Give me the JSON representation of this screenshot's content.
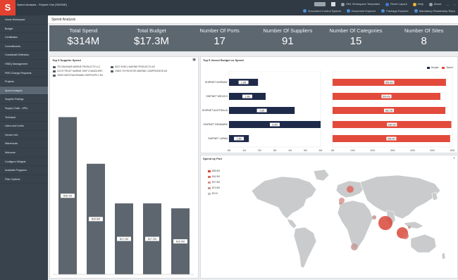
{
  "titlebar": {
    "title": "Spend Analysis - Shipnet One [SNONE]",
    "links": [
      "SN1 Workspace Templates",
      "Reset Layout",
      "Help",
      "About"
    ],
    "sublinks": [
      "Document Control System",
      "Document Explorer",
      "Package Explorer",
      "Mandatory Readership Repo"
    ],
    "logo": "S"
  },
  "sidebar": {
    "items": [
      {
        "label": "Home Workspace"
      },
      {
        "label": "Budget"
      },
      {
        "label": "Certificates"
      },
      {
        "label": "Commitments"
      },
      {
        "label": "Crankshaft Deflection"
      },
      {
        "label": "HSEQ Management"
      },
      {
        "label": "PMS Change Requests"
      },
      {
        "label": "Projects"
      },
      {
        "label": "Spend Analysis"
      },
      {
        "label": "Supplier Ratings"
      },
      {
        "label": "Supply Chain - KPIs"
      },
      {
        "label": "Technical"
      },
      {
        "label": "Users and Limits"
      },
      {
        "label": "Vendor Info"
      },
      {
        "label": "Warehouse"
      },
      {
        "label": "Welcome"
      },
      {
        "label": "Configure Widgets"
      },
      {
        "label": "Available Programs"
      },
      {
        "label": "Filter Options"
      }
    ],
    "active_index": 8
  },
  "header": {
    "title": "Spend Analysis"
  },
  "kpis": [
    {
      "label": "Total Spend",
      "value": "$314M"
    },
    {
      "label": "Total Budget",
      "value": "$17.3M"
    },
    {
      "label": "Number Of Ports",
      "value": "17"
    },
    {
      "label": "Number Of Suppliers",
      "value": "91"
    },
    {
      "label": "Number Of Categories",
      "value": "15"
    },
    {
      "label": "Number Of Sites",
      "value": "8"
    }
  ],
  "supplier_panel": {
    "title": "Top 5 Supplier Spend",
    "legend": [
      "TECHNOMAR MARINE PRODUCTS LLC",
      "22175 TRUST MARINE SHIP CHANDLERS",
      "23923 WESTHAGEMANN SHIPSUPPLY BV",
      "8237 SHELL MARINE PRODUCTS AS",
      "24902 THYROSTOR MARINE COMPRESSOR AS"
    ]
  },
  "vessel_panel": {
    "title": "Top 5 Vessel Budget vs Spend",
    "legend": [
      "Budget",
      "Spend"
    ]
  },
  "port_panel": {
    "title": "Spend by Port",
    "legend": [
      "$55.9M",
      "$41.9M",
      "$27.9M",
      "$13.9M",
      "$0.01"
    ]
  },
  "colors": {
    "budget": "#1f2a4a",
    "spend": "#e24b3b",
    "supplier_bar": "#5d666e",
    "sidebar": "#38434d",
    "kpi_band": "#5d6770",
    "map_land": "#c9cbcd"
  },
  "chart_data": [
    {
      "type": "bar",
      "title": "Top 5 Supplier Spend",
      "categories": [
        "TECHNOMAR MARINE PRODUCTS LLC",
        "22175 TRUST MARINE SHIP CHANDLERS",
        "23923 WESTHAGEMANN SHIPSUPPLY BV",
        "8237 SHELL MARINE PRODUCTS AS",
        "24902 THYROSTOR MARINE COMPRESSOR AS"
      ],
      "values": [
        38.1,
        26.8,
        17.2,
        17.2,
        16.0
      ],
      "labels": [
        "$38.1M",
        "$26.8M",
        "$17.2M",
        "$17.2M",
        "$16.0M"
      ],
      "ylim": [
        0,
        45
      ]
    },
    {
      "type": "bar",
      "title": "Top 5 Vessel Budget vs Spend",
      "orientation": "horizontal",
      "categories": [
        "SHIPNET NORWAY",
        "SHIPNET MEXICO",
        "SHIPNET AUSTRALIA",
        "SHIPNET DENMARK",
        "SHIPNET JAPAN"
      ],
      "panels": [
        {
          "name": "Budget",
          "xlabel": "Budget",
          "ticks": [
            "0M",
            "1M",
            "2M",
            "3M",
            "4M",
            "5M",
            "6M"
          ],
          "xlim": [
            0,
            6
          ],
          "values": [
            1.9,
            2.4,
            4.3,
            6.0,
            1.3
          ],
          "labels": [
            "1.9M",
            "2.4M",
            "4.3M",
            "6.0M",
            "1.3M"
          ],
          "color": "#1f2a4a"
        },
        {
          "name": "Spend",
          "xlabel": "Spend",
          "ticks": [
            "0M",
            "10M",
            "20M",
            "30M",
            "40M",
            "50M",
            "60M"
          ],
          "xlim": [
            0,
            60
          ],
          "values": [
            56.8,
            54.0,
            56.5,
            59.5,
            58.9
          ],
          "labels": [
            "$56.8M",
            "$54.0M",
            "$56.5M",
            "$59.5M",
            "$58.9M"
          ],
          "color": "#e24b3b"
        }
      ]
    }
  ]
}
